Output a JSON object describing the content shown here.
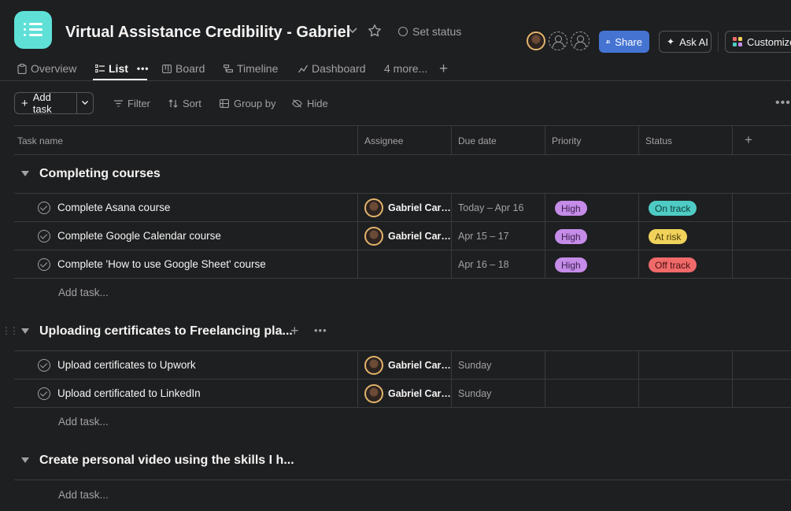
{
  "project": {
    "title": "Virtual Assistance Credibility - Gabriel",
    "set_status": "Set status",
    "icon_color": "#5ee0d7"
  },
  "header_buttons": {
    "share": "Share",
    "ask_ai": "Ask AI",
    "customize": "Customize"
  },
  "tabs": [
    {
      "label": "Overview",
      "icon": "clipboard-icon"
    },
    {
      "label": "List",
      "icon": "list-icon",
      "active": true
    },
    {
      "label": "Board",
      "icon": "board-icon"
    },
    {
      "label": "Timeline",
      "icon": "timeline-icon"
    },
    {
      "label": "Dashboard",
      "icon": "dashboard-icon"
    },
    {
      "label": "4 more...",
      "icon": ""
    }
  ],
  "toolbar": {
    "add_task": "Add task",
    "filter": "Filter",
    "sort": "Sort",
    "group_by": "Group by",
    "hide": "Hide"
  },
  "columns": [
    "Task name",
    "Assignee",
    "Due date",
    "Priority",
    "Status"
  ],
  "sections": [
    {
      "name": "Completing courses",
      "tasks": [
        {
          "name": "Complete Asana course",
          "assignee": "Gabriel Carat...",
          "due": "Today – Apr 16",
          "priority": "High",
          "status": "On track"
        },
        {
          "name": "Complete Google Calendar course",
          "assignee": "Gabriel Carat...",
          "due": "Apr 15 – 17",
          "priority": "High",
          "status": "At risk"
        },
        {
          "name": "Complete 'How to use Google Sheet' course",
          "assignee": "",
          "due": "Apr 16 – 18",
          "priority": "High",
          "status": "Off track"
        }
      ],
      "add_task": "Add task..."
    },
    {
      "name": "Uploading certificates to Freelancing pla...",
      "tasks": [
        {
          "name": "Upload certificates to Upwork",
          "assignee": "Gabriel Carat...",
          "due": "Sunday",
          "priority": "",
          "status": ""
        },
        {
          "name": "Upload certificated to LinkedIn",
          "assignee": "Gabriel Carat...",
          "due": "Sunday",
          "priority": "",
          "status": ""
        }
      ],
      "add_task": "Add task..."
    },
    {
      "name": "Create personal video using the skills I h...",
      "tasks": [],
      "add_task": "Add task..."
    }
  ],
  "colors": {
    "priority_high": "#c58ce8",
    "on_track": "#4ecbc4",
    "at_risk": "#f1d25b",
    "off_track": "#f06a6a",
    "share_button": "#4573d2"
  }
}
